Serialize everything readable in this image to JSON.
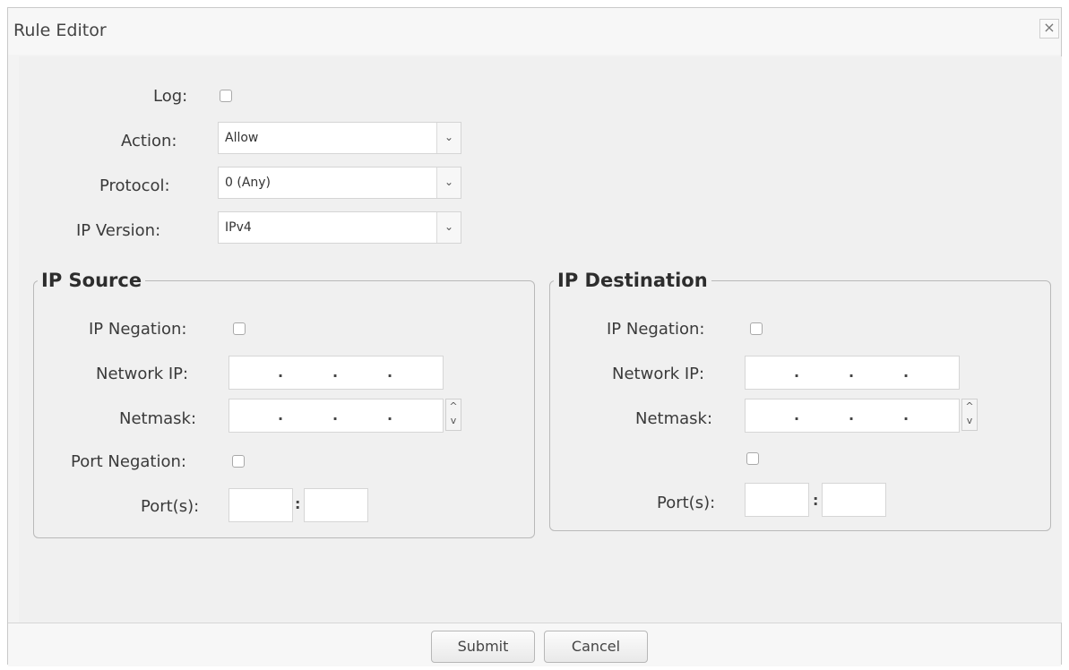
{
  "dialog": {
    "title": "Rule Editor",
    "close_symbol": "×"
  },
  "form": {
    "log_label": "Log:",
    "action_label": "Action:",
    "action_value": "Allow",
    "protocol_label": "Protocol:",
    "protocol_value": "0 (Any)",
    "ip_version_label": "IP Version:",
    "ip_version_value": "IPv4",
    "select_arrow": "⌄"
  },
  "source": {
    "legend": "IP Source",
    "ip_negation_label": "IP Negation:",
    "network_ip_label": "Network IP:",
    "netmask_label": "Netmask:",
    "port_negation_label": "Port Negation:",
    "ports_label": "Port(s):"
  },
  "destination": {
    "legend": "IP Destination",
    "ip_negation_label": "IP Negation:",
    "network_ip_label": "Network IP:",
    "netmask_label": "Netmask:",
    "ports_label": "Port(s):"
  },
  "symbols": {
    "ip_dot": ".",
    "port_colon": ":",
    "spin_up": "^",
    "spin_down": "v"
  },
  "footer": {
    "submit_label": "Submit",
    "cancel_label": "Cancel"
  }
}
